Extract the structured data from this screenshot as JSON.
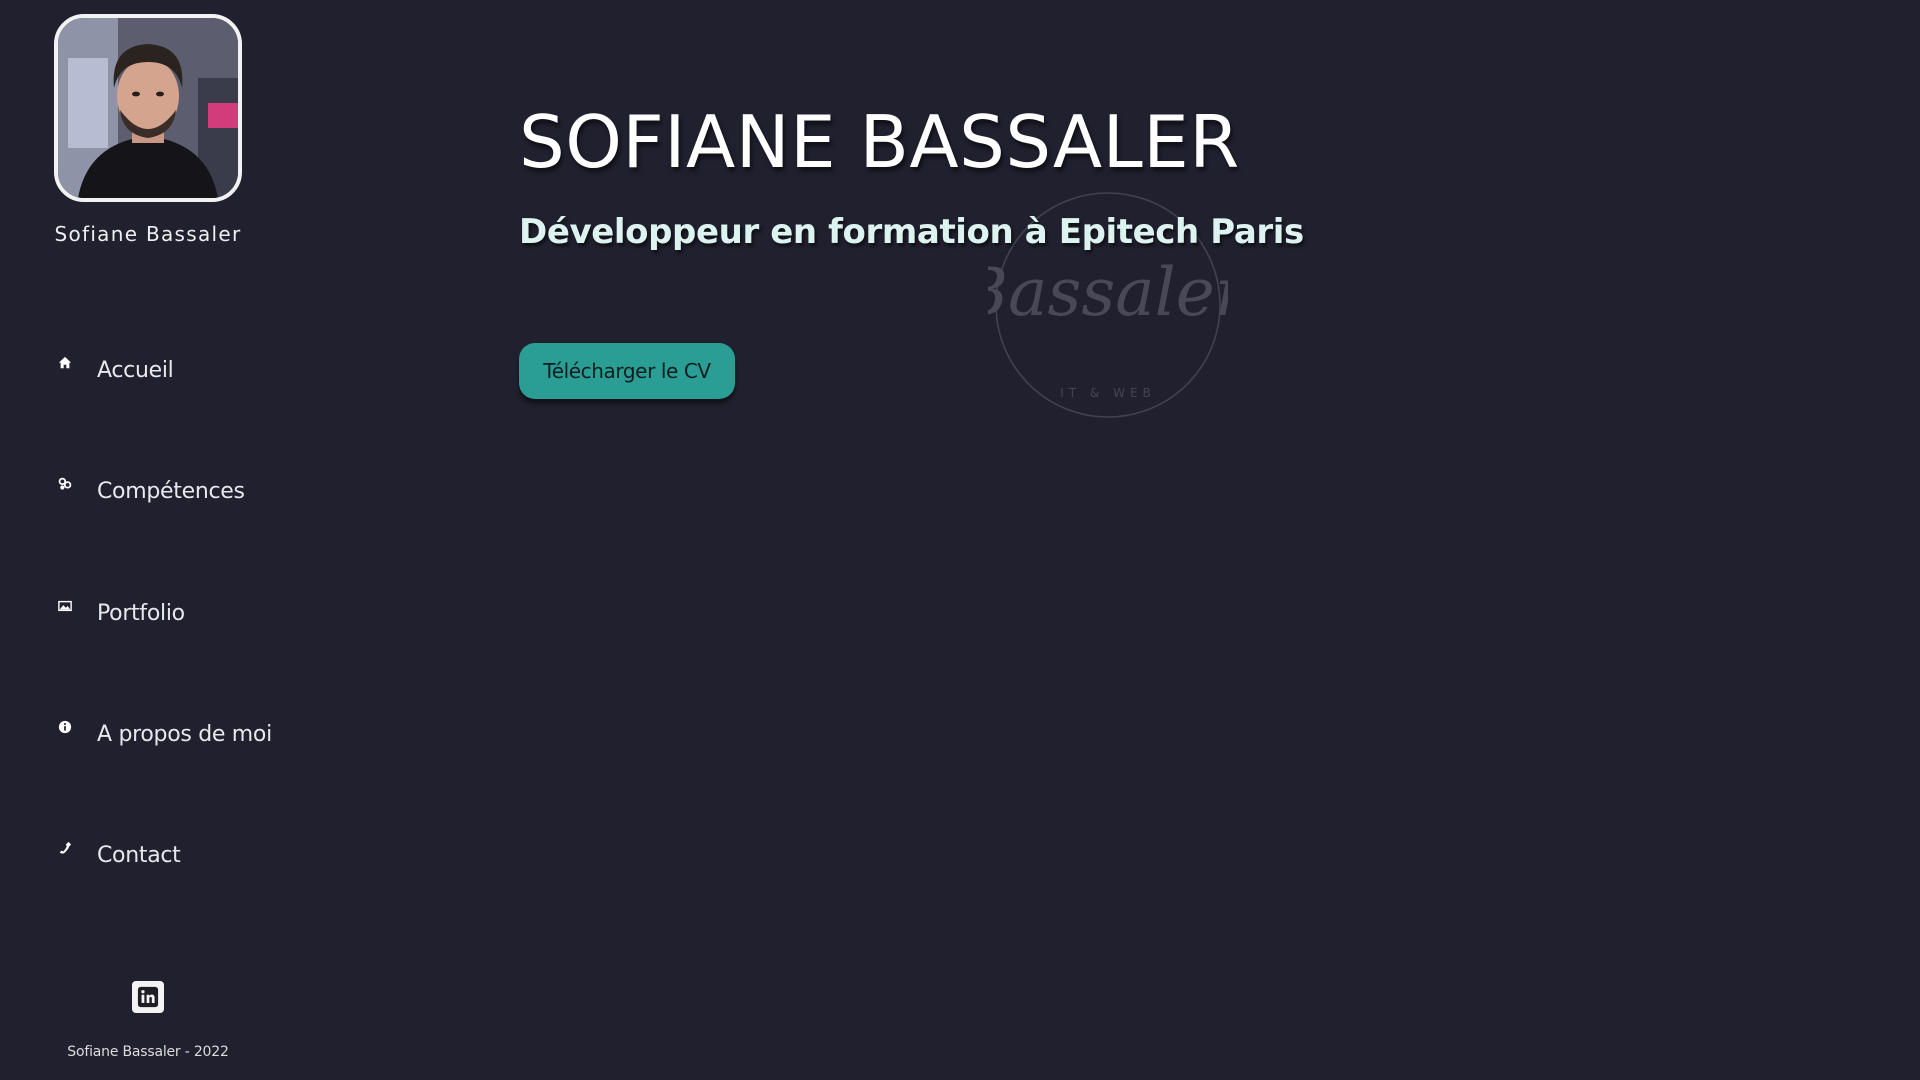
{
  "profile": {
    "name": "Sofiane Bassaler"
  },
  "nav": {
    "items": [
      {
        "label": "Accueil",
        "icon": "home-icon"
      },
      {
        "label": "Compétences",
        "icon": "skills-icon"
      },
      {
        "label": "Portfolio",
        "icon": "image-icon"
      },
      {
        "label": "A propos de moi",
        "icon": "info-icon"
      },
      {
        "label": "Contact",
        "icon": "phone-icon"
      }
    ]
  },
  "social": {
    "linkedin_icon": "linkedin-icon"
  },
  "footer": {
    "text": "Sofiane Bassaler - 2022"
  },
  "hero": {
    "title": "SOFIANE BASSALER",
    "subtitle": "Développeur en formation à Epitech Paris",
    "cv_button_label": "Télécharger le CV"
  },
  "watermark": {
    "logo_text": "Bassaler",
    "logo_tagline": "IT & WEB"
  },
  "colors": {
    "background": "#21202f",
    "accent": "#2a9d94",
    "text": "#ffffff"
  }
}
